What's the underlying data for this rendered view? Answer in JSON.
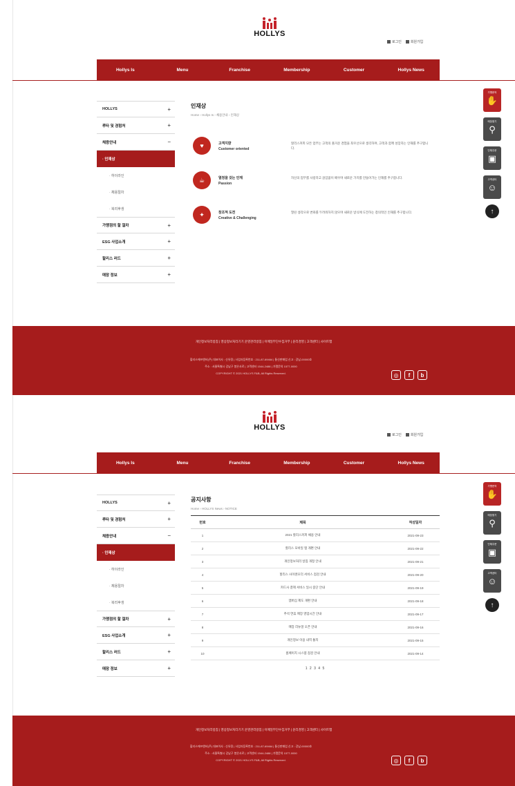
{
  "brand": {
    "logo_text": "HOLLYS",
    "color": "#a61c1c"
  },
  "header": {
    "login_label": "로그인",
    "join_label": "회원가입"
  },
  "gnb": [
    "Hollys Is",
    "Menu",
    "Franchise",
    "Membership",
    "Customer",
    "Hollys News"
  ],
  "lnb": {
    "items": [
      "HOLLYS",
      "루타 및 경험처",
      "채용안내",
      "· 인재상",
      "· 하이라인",
      "· 채용절차",
      "· 복리후생",
      "가맹점의 할 절차",
      "ESG 사업소개",
      "할리스 러드",
      "매장 정보"
    ]
  },
  "page1": {
    "title": "인재상",
    "breadcrumb": "Home › Hollys Is › 채용안내 › 인재상",
    "values": [
      {
        "icon": "heart-icon",
        "name_ko": "고객지향",
        "name_en": "Customer oriented",
        "desc": "할리스커피 모든 업무는 고객의 즐거운 경험을 최우선으로 생각하며, 고객과 함께 성장하는 인재를 추구합니다."
      },
      {
        "icon": "coffee-icon",
        "name_ko": "열정을 갖는 인재",
        "name_en": "Passion",
        "desc": "자신의 업무를 사랑하고 끊임없이 배우며 새로운 가치를 만들어가는 인재를 추구합니다."
      },
      {
        "icon": "lightbulb-icon",
        "name_ko": "창조적 도전",
        "name_en": "Creative & Challenging",
        "desc": "열린 생각으로 변화를 두려워하지 않으며 새로운 방식에 도전하는 창의적인 인재를 추구합니다."
      }
    ]
  },
  "page2": {
    "title": "공지사항",
    "breadcrumb": "Home › HOLLYS News › NOTICE",
    "columns": [
      "번호",
      "제목",
      "작성일자"
    ],
    "rows": [
      {
        "no": "1",
        "title": "2021 할리스커피 채용 안내",
        "date": "2021-09-23"
      },
      {
        "no": "2",
        "title": "할리스 모바일 앱 개편 안내",
        "date": "2021-09-22"
      },
      {
        "no": "3",
        "title": "개인정보처리 방침 개정 안내",
        "date": "2021-09-21"
      },
      {
        "no": "4",
        "title": "할리스 사이렌오더 서비스 점검 안내",
        "date": "2021-09-20"
      },
      {
        "no": "5",
        "title": "카드사 결제 서비스 일시 중단 안내",
        "date": "2021-09-19"
      },
      {
        "no": "6",
        "title": "멤버십 제도 개편 안내",
        "date": "2021-09-18"
      },
      {
        "no": "7",
        "title": "추석 연휴 매장 영업시간 안내",
        "date": "2021-09-17"
      },
      {
        "no": "8",
        "title": "매장 리뉴얼 오픈 안내",
        "date": "2021-09-16"
      },
      {
        "no": "9",
        "title": "개인정보 이용 내역 통지",
        "date": "2021-09-15"
      },
      {
        "no": "10",
        "title": "홈페이지 시스템 점검 안내",
        "date": "2021-09-14"
      }
    ],
    "pagination": "1 2 3 4 5"
  },
  "quick_menu": [
    {
      "label": "가맹문의",
      "icon": "handshake-icon",
      "style": "red"
    },
    {
      "label": "매장찾기",
      "icon": "search-icon",
      "style": "grey"
    },
    {
      "label": "단체주문",
      "icon": "store-icon",
      "style": "grey"
    },
    {
      "label": "고객센터",
      "icon": "people-icon",
      "style": "grey"
    }
  ],
  "footer": {
    "links": "개인정보처리방침 | 영상정보처리기기 운영관리방침 | 이메일무단수집거부 | 윤리경영 | 고객센터 | 사이트맵",
    "info1": "할리스에프앤비(주) 대표이사 : 신유정 | 사업자등록번호 : 211-87-69464 | 통신판매업 신고 : 강남-00000호",
    "info2": "주소 : 서울특별시 강남구 봉은사로 | 고객센터 1544-2488 | 가맹문의 1577-0000",
    "copyright": "COPYRIGHT © 2021 HOLLYS F&B, All Rights Reserved."
  }
}
